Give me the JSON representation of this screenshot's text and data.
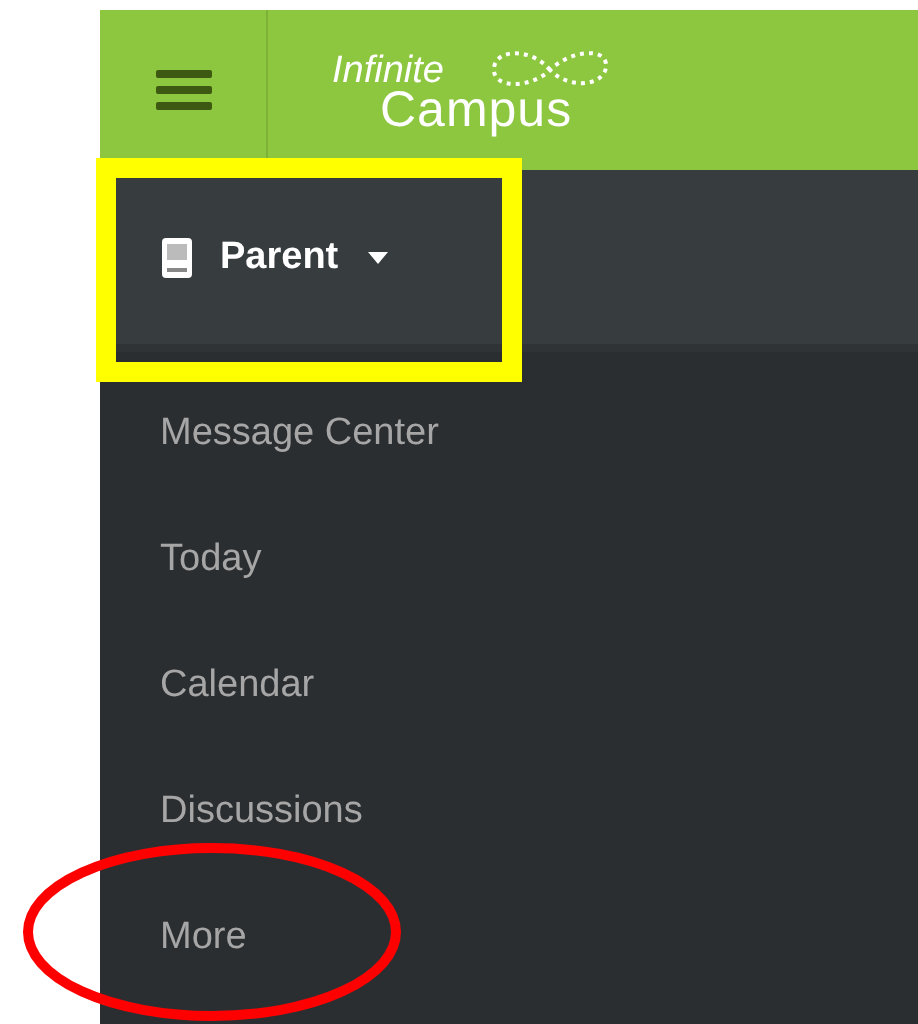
{
  "header": {
    "logo_line_1": "Infinite",
    "logo_line_2": "Campus"
  },
  "role_selector": {
    "label": "Parent",
    "expanded": false
  },
  "menu_items": [
    {
      "label": "Message Center"
    },
    {
      "label": "Today"
    },
    {
      "label": "Calendar"
    },
    {
      "label": "Discussions"
    },
    {
      "label": "More"
    }
  ]
}
